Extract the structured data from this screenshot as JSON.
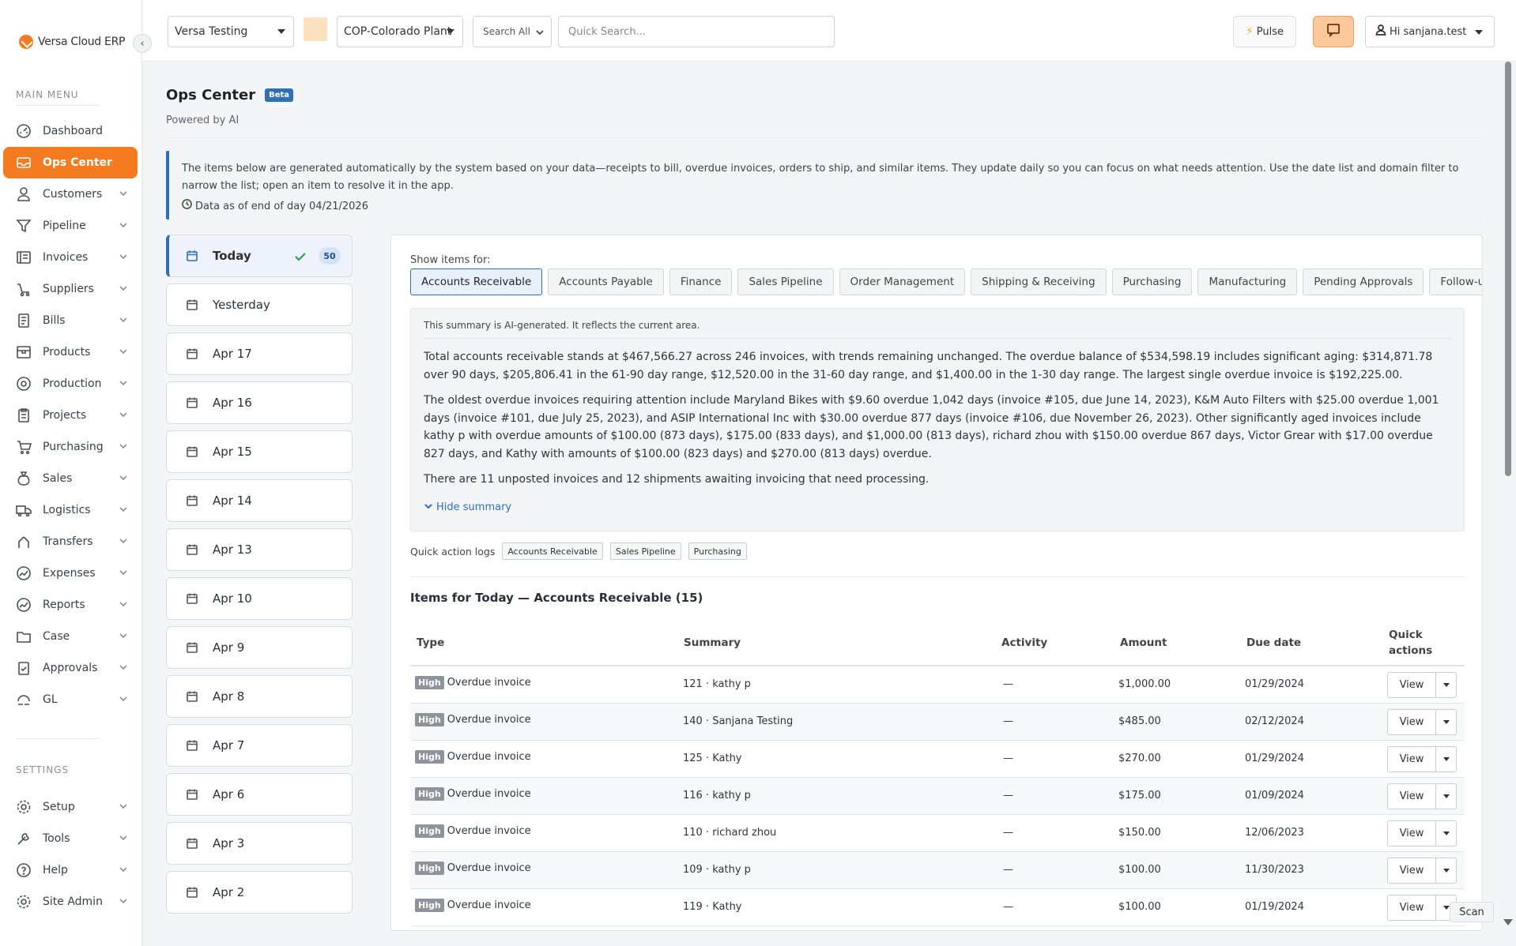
{
  "brand": {
    "name": "Versa Cloud ERP",
    "accent": "#f47b20",
    "link": "#2e6fb7"
  },
  "sidebar": {
    "main_menu_label": "MAIN MENU",
    "settings_label": "SETTINGS",
    "items": [
      {
        "label": "Dashboard",
        "icon": "dashboard-icon"
      },
      {
        "label": "Ops Center",
        "icon": "inbox-icon"
      },
      {
        "label": "Customers",
        "icon": "user-icon"
      },
      {
        "label": "Pipeline",
        "icon": "filter-icon"
      },
      {
        "label": "Invoices",
        "icon": "invoice-icon"
      },
      {
        "label": "Suppliers",
        "icon": "truck-icon"
      },
      {
        "label": "Bills",
        "icon": "bill-icon"
      },
      {
        "label": "Products",
        "icon": "box-icon"
      },
      {
        "label": "Production",
        "icon": "factory-icon"
      },
      {
        "label": "Projects",
        "icon": "clipboard-icon"
      },
      {
        "label": "Purchasing",
        "icon": "cart-icon"
      },
      {
        "label": "Sales",
        "icon": "money-bag-icon"
      },
      {
        "label": "Logistics",
        "icon": "delivery-icon"
      },
      {
        "label": "Transfers",
        "icon": "transfer-icon"
      },
      {
        "label": "Expenses",
        "icon": "chart-line-icon"
      },
      {
        "label": "Reports",
        "icon": "report-icon"
      },
      {
        "label": "Case",
        "icon": "folder-icon"
      },
      {
        "label": "Approvals",
        "icon": "check-clipboard-icon"
      },
      {
        "label": "GL",
        "icon": "ledger-icon"
      }
    ],
    "settings_items": [
      {
        "label": "Setup",
        "icon": "gear-icon"
      },
      {
        "label": "Tools",
        "icon": "tools-icon"
      },
      {
        "label": "Help",
        "icon": "help-icon"
      },
      {
        "label": "Site Admin",
        "icon": "admin-gear-icon"
      }
    ]
  },
  "topbar": {
    "company": "Versa Testing",
    "location": "COP-Colorado Plant",
    "search_scope": "Search All",
    "quick_search_placeholder": "Quick Search...",
    "pulse_label": "Pulse",
    "user_label": "Hi sanjana.test"
  },
  "page": {
    "title": "Ops Center",
    "beta": "Beta",
    "subtitle": "Powered by AI",
    "info_text": "The items below are generated automatically by the system based on your data—receipts to bill, overdue invoices, orders to ship, and similar items. They update daily so you can focus on what needs attention. Use the date list and domain filter to narrow the list; open an item to resolve it in the app.",
    "data_as_of": "Data as of end of day 04/21/2026"
  },
  "dates": [
    {
      "label": "Today",
      "count": "50"
    },
    {
      "label": "Yesterday"
    },
    {
      "label": "Apr 17"
    },
    {
      "label": "Apr 16"
    },
    {
      "label": "Apr 15"
    },
    {
      "label": "Apr 14"
    },
    {
      "label": "Apr 13"
    },
    {
      "label": "Apr 10"
    },
    {
      "label": "Apr 9"
    },
    {
      "label": "Apr 8"
    },
    {
      "label": "Apr 7"
    },
    {
      "label": "Apr 6"
    },
    {
      "label": "Apr 3"
    },
    {
      "label": "Apr 2"
    }
  ],
  "panel": {
    "show_items_label": "Show items for:",
    "domains": [
      "Accounts Receivable",
      "Accounts Payable",
      "Finance",
      "Sales Pipeline",
      "Order Management",
      "Shipping & Receiving",
      "Purchasing",
      "Manufacturing",
      "Pending Approvals",
      "Follow-ups"
    ],
    "summary_note": "This summary is AI-generated. It reflects the current area.",
    "summary_paragraphs": [
      "Total accounts receivable stands at $467,566.27 across 246 invoices, with trends remaining unchanged. The overdue balance of $534,598.19 includes significant aging: $314,871.78 over 90 days, $205,806.41 in the 61-90 day range, $12,520.00 in the 31-60 day range, and $1,400.00 in the 1-30 day range. The largest single overdue invoice is $192,225.00.",
      "The oldest overdue invoices requiring attention include Maryland Bikes with $9.60 overdue 1,042 days (invoice #105, due June 14, 2023), K&M Auto Filters with $25.00 overdue 1,001 days (invoice #101, due July 25, 2023), and ASIP International Inc with $30.00 overdue 877 days (invoice #106, due November 26, 2023). Other significantly aged invoices include kathy p with overdue amounts of $100.00 (873 days), $175.00 (833 days), and $1,000.00 (813 days), richard zhou with $150.00 overdue 867 days, Victor Grear with $17.00 overdue 827 days, and Kathy with amounts of $100.00 (823 days) and $270.00 (813 days) overdue.",
      "There are 11 unposted invoices and 12 shipments awaiting invoicing that need processing."
    ],
    "hide_summary": "Hide summary",
    "quick_action_label": "Quick action logs",
    "quick_action_chips": [
      "Accounts Receivable",
      "Sales Pipeline",
      "Purchasing"
    ],
    "items_title": "Items for Today — Accounts Receivable (15)"
  },
  "table": {
    "headers": {
      "type": "Type",
      "summary": "Summary",
      "activity": "Activity",
      "amount": "Amount",
      "due": "Due date",
      "actions": "Quick actions"
    },
    "view_label": "View",
    "rows": [
      {
        "priority": "High",
        "type": "Overdue invoice",
        "summary": "121 · kathy p",
        "activity": "—",
        "amount": "$1,000.00",
        "due": "01/29/2024"
      },
      {
        "priority": "High",
        "type": "Overdue invoice",
        "summary": "140 · Sanjana Testing",
        "activity": "—",
        "amount": "$485.00",
        "due": "02/12/2024"
      },
      {
        "priority": "High",
        "type": "Overdue invoice",
        "summary": "125 · Kathy",
        "activity": "—",
        "amount": "$270.00",
        "due": "01/29/2024"
      },
      {
        "priority": "High",
        "type": "Overdue invoice",
        "summary": "116 · kathy p",
        "activity": "—",
        "amount": "$175.00",
        "due": "01/09/2024"
      },
      {
        "priority": "High",
        "type": "Overdue invoice",
        "summary": "110 · richard zhou",
        "activity": "—",
        "amount": "$150.00",
        "due": "12/06/2023"
      },
      {
        "priority": "High",
        "type": "Overdue invoice",
        "summary": "109 · kathy p",
        "activity": "—",
        "amount": "$100.00",
        "due": "11/30/2023"
      },
      {
        "priority": "High",
        "type": "Overdue invoice",
        "summary": "119 · Kathy",
        "activity": "—",
        "amount": "$100.00",
        "due": "01/19/2024"
      }
    ]
  },
  "scan_label": "Scan"
}
